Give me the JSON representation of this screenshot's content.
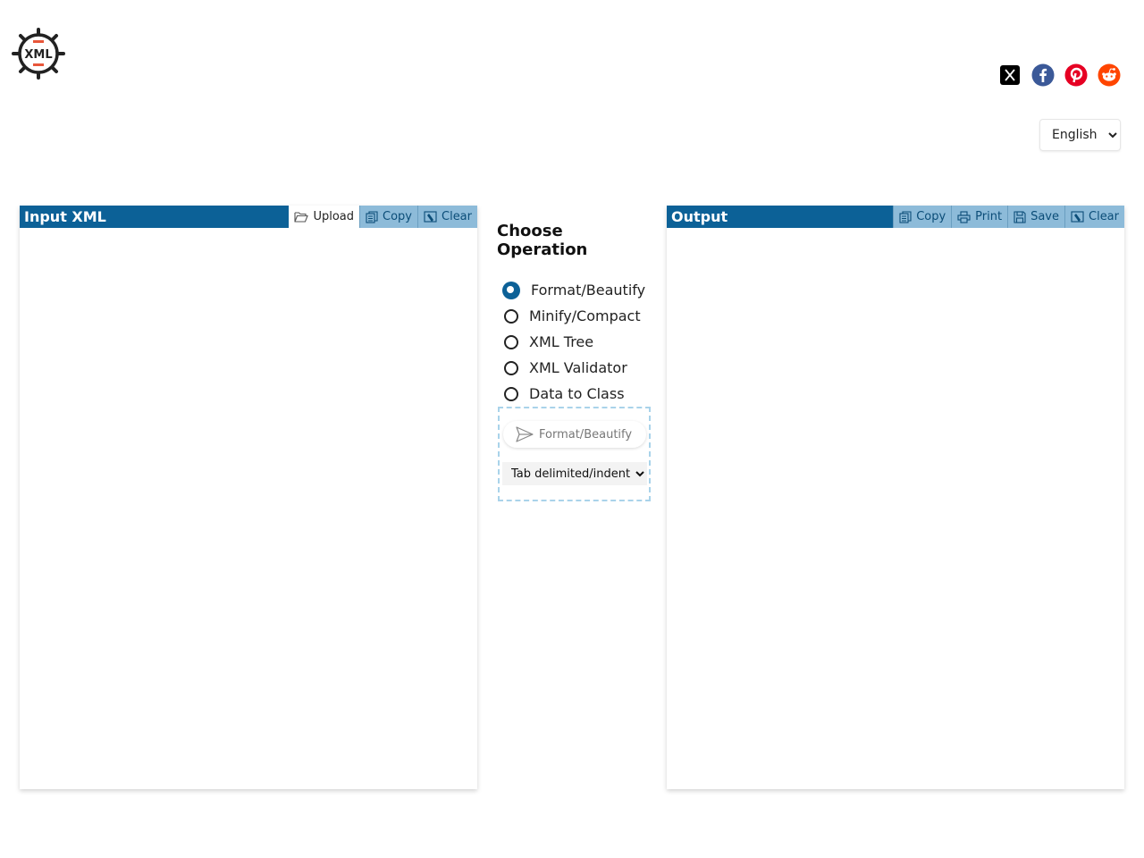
{
  "logo": {
    "text": "XML"
  },
  "social": {
    "items": [
      {
        "name": "x-twitter",
        "color": "#000000"
      },
      {
        "name": "facebook",
        "color": "#3b5998"
      },
      {
        "name": "pinterest",
        "color": "#e60023"
      },
      {
        "name": "reddit",
        "color": "#ff4500"
      }
    ]
  },
  "language": {
    "selected": "English"
  },
  "input_panel": {
    "title": "Input XML",
    "upload_label": "Upload",
    "copy_label": "Copy",
    "clear_label": "Clear"
  },
  "operations": {
    "heading": "Choose Operation",
    "selected": "Format/Beautify",
    "items": [
      "Format/Beautify",
      "Minify/Compact",
      "XML Tree",
      "XML Validator",
      "Data to Class"
    ],
    "run_label": "Format/Beautify",
    "indent_option": "Tab delimited/indent"
  },
  "output_panel": {
    "title": "Output",
    "copy_label": "Copy",
    "print_label": "Print",
    "save_label": "Save",
    "clear_label": "Clear"
  },
  "colors": {
    "header": "#0c6197",
    "button": "#8dbbd9",
    "dashed": "#a9d3ea"
  }
}
